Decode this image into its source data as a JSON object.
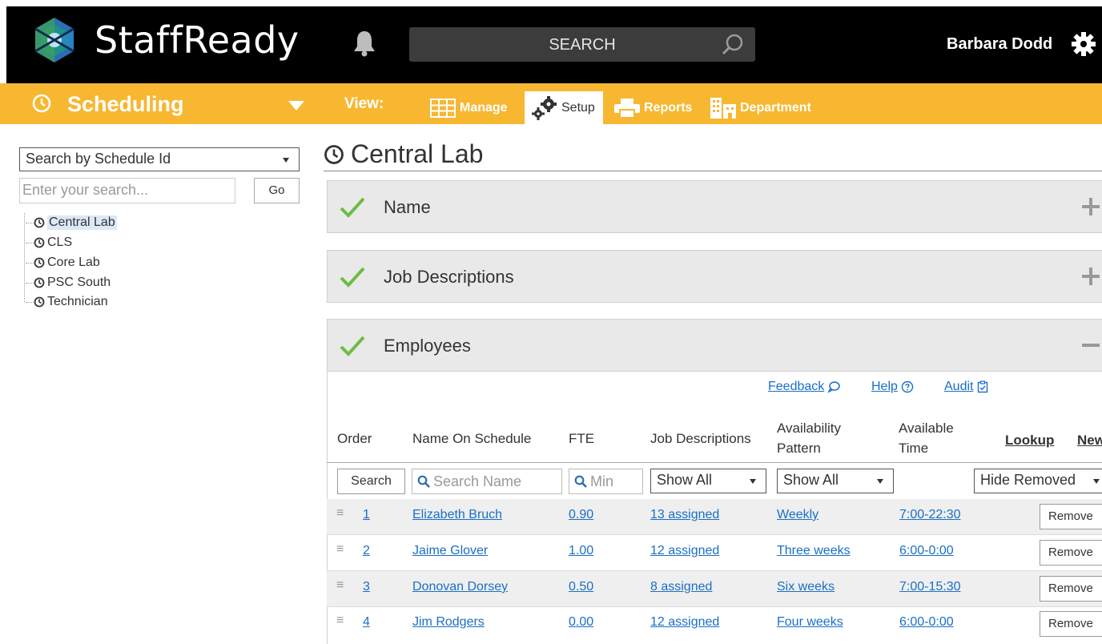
{
  "app": {
    "brand": "StaffReady",
    "search_label": "SEARCH",
    "user_name": "Barbara Dodd"
  },
  "nav": {
    "module": "Scheduling",
    "view_label": "View:",
    "tabs": [
      {
        "label": "Manage",
        "icon": "grid-icon"
      },
      {
        "label": "Setup",
        "icon": "gears-icon",
        "active": true
      },
      {
        "label": "Reports",
        "icon": "printer-icon"
      },
      {
        "label": "Department",
        "icon": "building-icon"
      }
    ]
  },
  "sidebar": {
    "search_mode": "Search by Schedule Id",
    "search_placeholder": "Enter your search...",
    "go_label": "Go",
    "tree": [
      {
        "label": "Central Lab",
        "selected": true
      },
      {
        "label": "CLS"
      },
      {
        "label": "Core Lab"
      },
      {
        "label": "PSC South"
      },
      {
        "label": "Technician"
      }
    ]
  },
  "main": {
    "title": "Central Lab",
    "sections": [
      {
        "label": "Name",
        "state": "collapsed"
      },
      {
        "label": "Job Descriptions",
        "state": "collapsed"
      },
      {
        "label": "Employees",
        "state": "expanded"
      }
    ],
    "links": {
      "feedback": "Feedback",
      "help": "Help",
      "audit": "Audit"
    },
    "columns": {
      "order": "Order",
      "name": "Name On Schedule",
      "fte": "FTE",
      "jobs": "Job Descriptions",
      "availability_line1": "Availability",
      "availability_line2": "Pattern",
      "time_line1": "Available",
      "time_line2": "Time",
      "lookup": "Lookup",
      "new": "New"
    },
    "filters": {
      "search_button": "Search",
      "name_placeholder": "Search Name",
      "fte_placeholder": "Min",
      "jobs_select": "Show All",
      "availability_select": "Show All",
      "removed_select": "Hide Removed"
    },
    "rows": [
      {
        "order": "1",
        "name": "Elizabeth Bruch",
        "fte": "0.90",
        "jobs": "13 assigned",
        "pattern": "Weekly",
        "time": "7:00-22:30",
        "action": "Remove"
      },
      {
        "order": "2",
        "name": "Jaime Glover",
        "fte": "1.00",
        "jobs": "12 assigned",
        "pattern": "Three weeks",
        "time": "6:00-0:00",
        "action": "Remove"
      },
      {
        "order": "3",
        "name": "Donovan Dorsey",
        "fte": "0.50",
        "jobs": "8 assigned",
        "pattern": "Six weeks",
        "time": "7:00-15:30",
        "action": "Remove"
      },
      {
        "order": "4",
        "name": "Jim Rodgers",
        "fte": "0.00",
        "jobs": "12 assigned",
        "pattern": "Four weeks",
        "time": "6:00-0:00",
        "action": "Remove"
      }
    ]
  },
  "colors": {
    "topbar": "#000000",
    "navbar": "#f7b731",
    "link": "#1a6fc4",
    "check": "#6cbd45"
  }
}
